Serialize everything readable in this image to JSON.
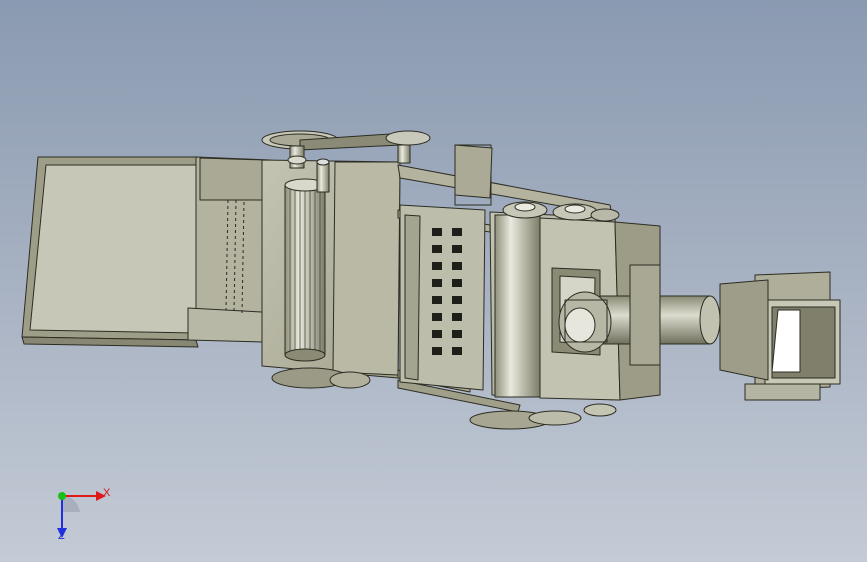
{
  "triad": {
    "x_label": "X",
    "z_label": "Z",
    "colors": {
      "x": "#e01818",
      "y": "#18c018",
      "z": "#2030e0"
    }
  },
  "scene": {
    "icons": [
      "cad-assembly-model",
      "orientation-triad-icon"
    ]
  }
}
